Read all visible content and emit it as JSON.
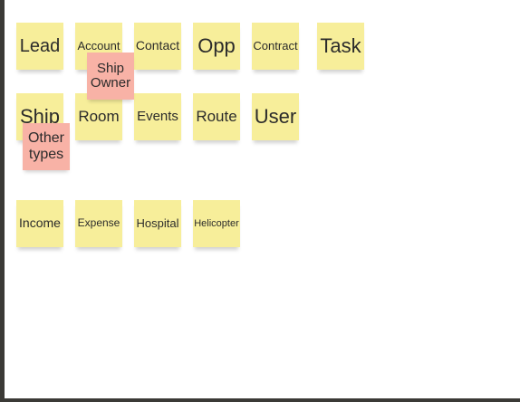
{
  "colors": {
    "yellow_note": "#f7ee9a",
    "pink_note": "#f8b2a6",
    "text": "#2b2b2b",
    "frame": "#3b3a36"
  },
  "notes": {
    "lead": "Lead",
    "account": "Account",
    "contact": "Contact",
    "opp": "Opp",
    "contract": "Contract",
    "task": "Task",
    "ship": "Ship",
    "room": "Room",
    "events": "Events",
    "route": "Route",
    "user": "User",
    "income": "Income",
    "expense": "Expense",
    "hospital": "Hospital",
    "helicopter": "Helicopter",
    "ship_owner": "Ship Owner",
    "other_types": "Other types"
  }
}
